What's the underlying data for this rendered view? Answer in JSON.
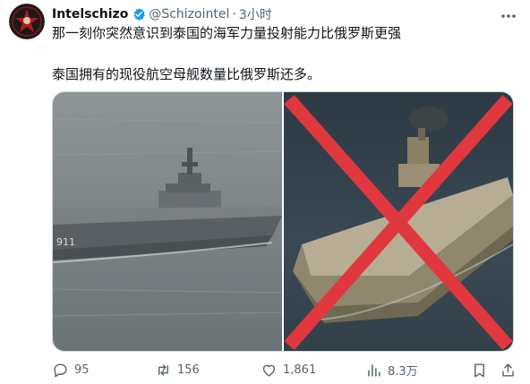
{
  "post": {
    "author_name": "Intelschizo",
    "handle": "@Schizointel",
    "separator": "·",
    "time": "3小时",
    "line1": "那一刻你突然意识到泰国的海军力量投射能力比俄罗斯更强",
    "line2": "泰国拥有的现役航空母舰数量比俄罗斯还多。"
  },
  "media": {
    "left_image": "thai-aircraft-carrier",
    "right_image": "russian-aircraft-carrier-crossed-out",
    "hull_number": "911",
    "cross_color": "#e0383e"
  },
  "actions": {
    "replies": "95",
    "reposts": "156",
    "likes": "1,861",
    "views": "8.3万"
  },
  "colors": {
    "text": "#0f1419",
    "secondary": "#536471",
    "verified": "#1d9bf0"
  }
}
